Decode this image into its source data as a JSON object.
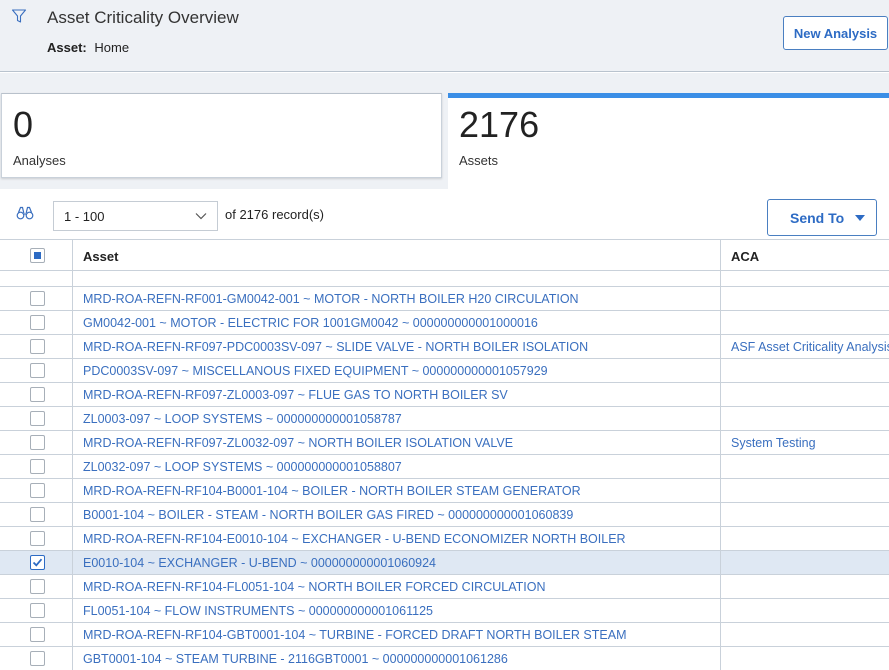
{
  "header": {
    "title": "Asset Criticality Overview",
    "asset_label": "Asset:",
    "asset_value": "Home",
    "new_analysis_label": "New Analysis"
  },
  "tiles": {
    "analyses": {
      "count": "0",
      "label": "Analyses"
    },
    "assets": {
      "count": "2176",
      "label": "Assets"
    }
  },
  "toolbar": {
    "pager_value": "1 - 100",
    "records_text": "of 2176 record(s)",
    "send_to_label": "Send To"
  },
  "grid": {
    "columns": [
      "Asset",
      "ACA"
    ],
    "rows": [
      {
        "asset": "MRD-ROA-REFN-RF001-GM0042-001 ~ MOTOR - NORTH BOILER H20 CIRCULATION",
        "aca": "",
        "checked": false
      },
      {
        "asset": "GM0042-001 ~ MOTOR - ELECTRIC FOR 1001GM0042 ~ 000000000001000016",
        "aca": "",
        "checked": false
      },
      {
        "asset": "MRD-ROA-REFN-RF097-PDC0003SV-097 ~ SLIDE VALVE - NORTH BOILER ISOLATION",
        "aca": "ASF Asset Criticality Analysis",
        "checked": false
      },
      {
        "asset": "PDC0003SV-097 ~ MISCELLANOUS FIXED EQUIPMENT ~ 000000000001057929",
        "aca": "",
        "checked": false
      },
      {
        "asset": "MRD-ROA-REFN-RF097-ZL0003-097 ~ FLUE GAS TO NORTH BOILER SV",
        "aca": "",
        "checked": false
      },
      {
        "asset": "ZL0003-097 ~ LOOP SYSTEMS ~ 000000000001058787",
        "aca": "",
        "checked": false
      },
      {
        "asset": "MRD-ROA-REFN-RF097-ZL0032-097 ~ NORTH BOILER ISOLATION VALVE",
        "aca": "System Testing",
        "checked": false
      },
      {
        "asset": "ZL0032-097 ~ LOOP SYSTEMS ~ 000000000001058807",
        "aca": "",
        "checked": false
      },
      {
        "asset": "MRD-ROA-REFN-RF104-B0001-104 ~ BOILER - NORTH BOILER STEAM GENERATOR",
        "aca": "",
        "checked": false
      },
      {
        "asset": "B0001-104 ~ BOILER - STEAM - NORTH BOILER GAS FIRED ~ 000000000001060839",
        "aca": "",
        "checked": false
      },
      {
        "asset": "MRD-ROA-REFN-RF104-E0010-104 ~ EXCHANGER - U-BEND ECONOMIZER NORTH BOILER",
        "aca": "",
        "checked": false
      },
      {
        "asset": "E0010-104 ~ EXCHANGER - U-BEND ~ 000000000001060924",
        "aca": "",
        "checked": true
      },
      {
        "asset": "MRD-ROA-REFN-RF104-FL0051-104 ~ NORTH BOILER FORCED CIRCULATION",
        "aca": "",
        "checked": false
      },
      {
        "asset": "FL0051-104 ~ FLOW INSTRUMENTS ~ 000000000001061125",
        "aca": "",
        "checked": false
      },
      {
        "asset": "MRD-ROA-REFN-RF104-GBT0001-104 ~ TURBINE - FORCED DRAFT NORTH BOILER STEAM",
        "aca": "",
        "checked": false
      },
      {
        "asset": "GBT0001-104 ~ STEAM TURBINE - 2116GBT0001 ~ 000000000001061286",
        "aca": "",
        "checked": false
      }
    ]
  },
  "colors": {
    "accent": "#2d6bc4",
    "selected_row": "#dfe8f3",
    "tile_active": "#3a8ee6"
  },
  "icons": {
    "filter": "filter-icon",
    "find": "binoculars-icon",
    "dropdown": "chevron-down-icon"
  }
}
